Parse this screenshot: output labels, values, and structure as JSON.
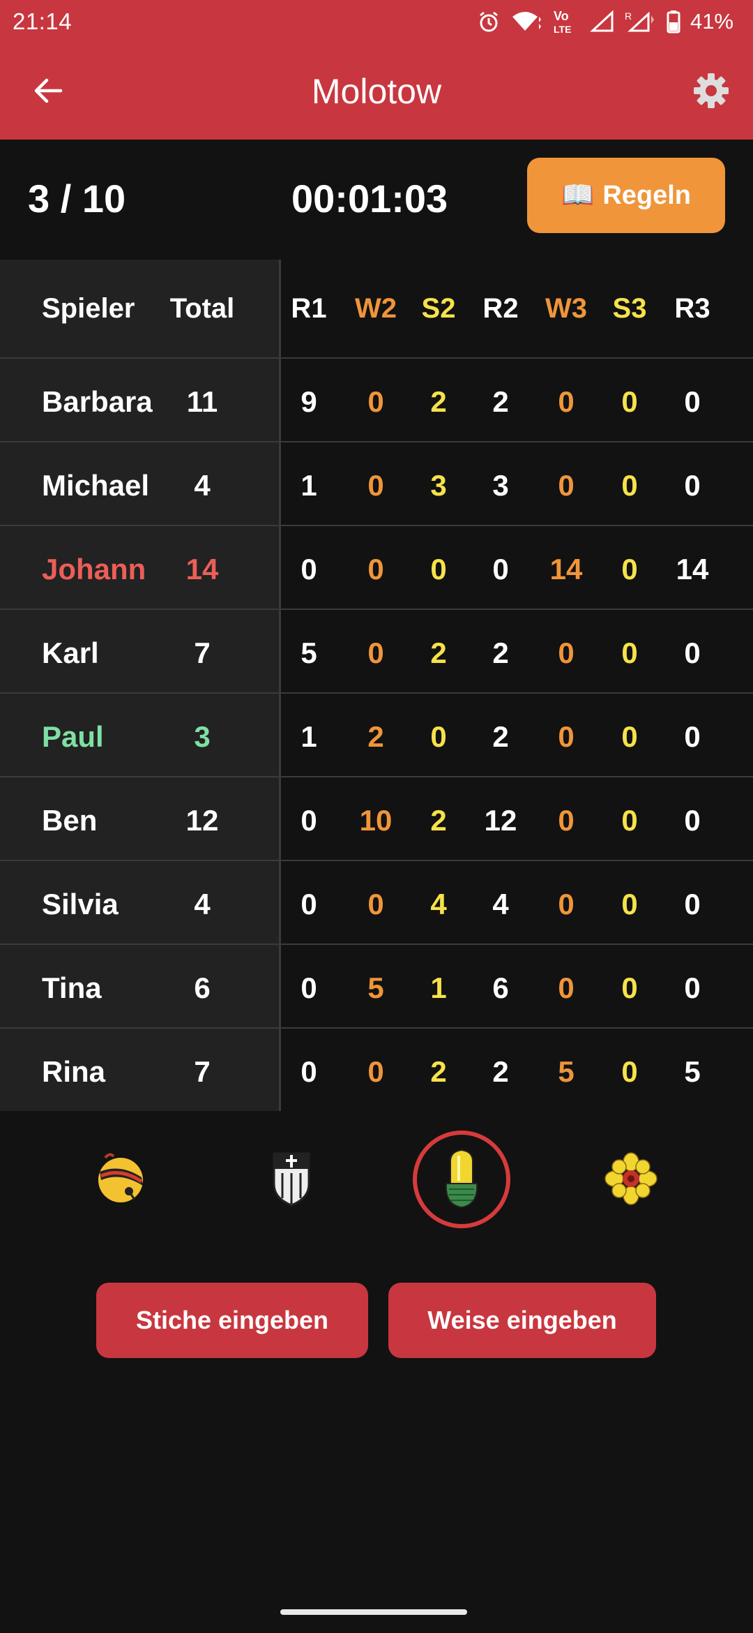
{
  "status_bar": {
    "time": "21:14",
    "battery": "41%",
    "icons": [
      "alarm-icon",
      "wifi-icon",
      "volte-icon",
      "signal-icon",
      "signal-roaming-icon",
      "battery-icon"
    ]
  },
  "app_bar": {
    "title": "Molotow",
    "back_icon": "arrow-left-icon",
    "settings_icon": "gear-icon"
  },
  "game": {
    "round_progress": "3 / 10",
    "timer": "00:01:03",
    "rules_button": {
      "icon": "📖",
      "label": "Regeln"
    }
  },
  "table": {
    "headers": {
      "player": "Spieler",
      "total": "Total",
      "rounds": [
        {
          "label": "R1",
          "color": "#ffffff"
        },
        {
          "label": "W2",
          "color": "#f0953a"
        },
        {
          "label": "S2",
          "color": "#f6e24a"
        },
        {
          "label": "R2",
          "color": "#ffffff"
        },
        {
          "label": "W3",
          "color": "#f0953a"
        },
        {
          "label": "S3",
          "color": "#f6e24a"
        },
        {
          "label": "R3",
          "color": "#ffffff"
        }
      ]
    },
    "rows": [
      {
        "name": "Barbara",
        "total": "11",
        "highlight": "none",
        "values": [
          "9",
          "0",
          "2",
          "2",
          "0",
          "0",
          "0"
        ]
      },
      {
        "name": "Michael",
        "total": "4",
        "highlight": "none",
        "values": [
          "1",
          "0",
          "3",
          "3",
          "0",
          "0",
          "0"
        ]
      },
      {
        "name": "Johann",
        "total": "14",
        "highlight": "red",
        "values": [
          "0",
          "0",
          "0",
          "0",
          "14",
          "0",
          "14"
        ]
      },
      {
        "name": "Karl",
        "total": "7",
        "highlight": "none",
        "values": [
          "5",
          "0",
          "2",
          "2",
          "0",
          "0",
          "0"
        ]
      },
      {
        "name": "Paul",
        "total": "3",
        "highlight": "green",
        "values": [
          "1",
          "2",
          "0",
          "2",
          "0",
          "0",
          "0"
        ]
      },
      {
        "name": "Ben",
        "total": "12",
        "highlight": "none",
        "values": [
          "0",
          "10",
          "2",
          "12",
          "0",
          "0",
          "0"
        ]
      },
      {
        "name": "Silvia",
        "total": "4",
        "highlight": "none",
        "values": [
          "0",
          "0",
          "4",
          "4",
          "0",
          "0",
          "0"
        ]
      },
      {
        "name": "Tina",
        "total": "6",
        "highlight": "none",
        "values": [
          "0",
          "5",
          "1",
          "6",
          "0",
          "0",
          "0"
        ]
      },
      {
        "name": "Rina",
        "total": "7",
        "highlight": "none",
        "values": [
          "0",
          "0",
          "2",
          "2",
          "5",
          "0",
          "5"
        ]
      }
    ]
  },
  "suits": {
    "items": [
      "schellen-icon",
      "schilten-icon",
      "eicheln-icon",
      "rosen-icon"
    ],
    "selected": "eicheln-icon"
  },
  "actions": {
    "tricks_label": "Stiche eingeben",
    "weise_label": "Weise eingeben"
  },
  "colors": {
    "primary": "#c8373f",
    "accent": "#f0953a",
    "weise": "#f0953a",
    "stich": "#f6e24a",
    "loser": "#ec5e58",
    "winner": "#7ee0a2",
    "background": "#121212"
  }
}
